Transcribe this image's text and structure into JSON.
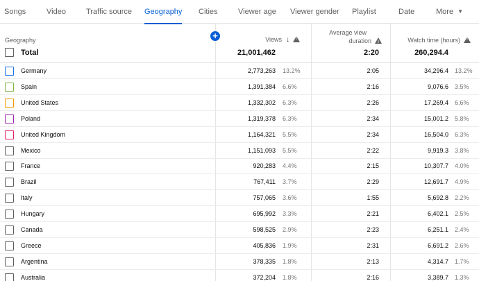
{
  "tabs": [
    {
      "label": "Songs",
      "active": false
    },
    {
      "label": "Video",
      "active": false
    },
    {
      "label": "Traffic source",
      "active": false
    },
    {
      "label": "Geography",
      "active": true
    },
    {
      "label": "Cities",
      "active": false
    },
    {
      "label": "Viewer age",
      "active": false
    },
    {
      "label": "Viewer gender",
      "active": false
    },
    {
      "label": "Playlist",
      "active": false
    },
    {
      "label": "Date",
      "active": false
    },
    {
      "label": "More",
      "active": false
    }
  ],
  "header": {
    "dimension": "Geography",
    "views": "Views",
    "avd_line1": "Average view",
    "avd_line2": "duration",
    "watch": "Watch time (hours)"
  },
  "total": {
    "label": "Total",
    "views": "21,001,462",
    "avd": "2:20",
    "watch": "260,294.4"
  },
  "rows": [
    {
      "name": "Germany",
      "color": "#1a73e8",
      "views": "2,773,263",
      "views_pct": "13.2%",
      "avd": "2:05",
      "watch": "34,296.4",
      "watch_pct": "13.2%"
    },
    {
      "name": "Spain",
      "color": "#7cb342",
      "views": "1,391,384",
      "views_pct": "6.6%",
      "avd": "2:16",
      "watch": "9,076.6",
      "watch_pct": "3.5%"
    },
    {
      "name": "United States",
      "color": "#f29900",
      "views": "1,332,302",
      "views_pct": "6.3%",
      "avd": "2:26",
      "watch": "17,269.4",
      "watch_pct": "6.6%"
    },
    {
      "name": "Poland",
      "color": "#9c27b0",
      "views": "1,319,378",
      "views_pct": "6.3%",
      "avd": "2:34",
      "watch": "15,001.2",
      "watch_pct": "5.8%"
    },
    {
      "name": "United Kingdom",
      "color": "#e91e63",
      "views": "1,164,321",
      "views_pct": "5.5%",
      "avd": "2:34",
      "watch": "16,504.0",
      "watch_pct": "6.3%"
    },
    {
      "name": "Mexico",
      "color": "#5f5f5f",
      "views": "1,151,093",
      "views_pct": "5.5%",
      "avd": "2:22",
      "watch": "9,919.3",
      "watch_pct": "3.8%"
    },
    {
      "name": "France",
      "color": "#5f5f5f",
      "views": "920,283",
      "views_pct": "4.4%",
      "avd": "2:15",
      "watch": "10,307.7",
      "watch_pct": "4.0%"
    },
    {
      "name": "Brazil",
      "color": "#5f5f5f",
      "views": "767,411",
      "views_pct": "3.7%",
      "avd": "2:29",
      "watch": "12,691.7",
      "watch_pct": "4.9%"
    },
    {
      "name": "Italy",
      "color": "#5f5f5f",
      "views": "757,065",
      "views_pct": "3.6%",
      "avd": "1:55",
      "watch": "5,692.8",
      "watch_pct": "2.2%"
    },
    {
      "name": "Hungary",
      "color": "#5f5f5f",
      "views": "695,992",
      "views_pct": "3.3%",
      "avd": "2:21",
      "watch": "6,402.1",
      "watch_pct": "2.5%"
    },
    {
      "name": "Canada",
      "color": "#5f5f5f",
      "views": "598,525",
      "views_pct": "2.9%",
      "avd": "2:23",
      "watch": "6,251.1",
      "watch_pct": "2.4%"
    },
    {
      "name": "Greece",
      "color": "#5f5f5f",
      "views": "405,836",
      "views_pct": "1.9%",
      "avd": "2:31",
      "watch": "6,691.2",
      "watch_pct": "2.6%"
    },
    {
      "name": "Argentina",
      "color": "#5f5f5f",
      "views": "378,335",
      "views_pct": "1.8%",
      "avd": "2:13",
      "watch": "4,314.7",
      "watch_pct": "1.7%"
    },
    {
      "name": "Australia",
      "color": "#5f5f5f",
      "views": "372,204",
      "views_pct": "1.8%",
      "avd": "2:16",
      "watch": "3,389.7",
      "watch_pct": "1.3%"
    }
  ]
}
